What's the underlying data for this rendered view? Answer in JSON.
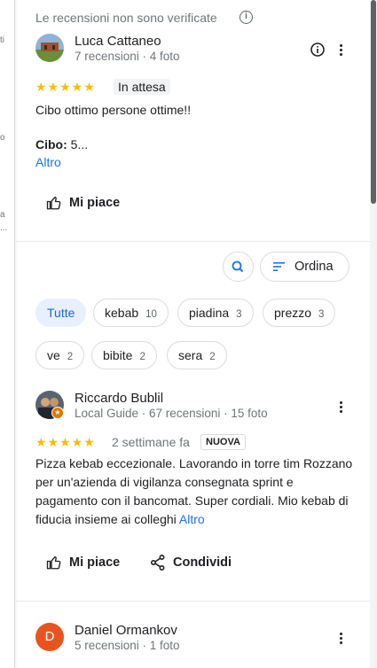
{
  "left_strip": {
    "fragments": [
      "ti",
      "o",
      "a",
      "..."
    ]
  },
  "header": {
    "unverified_note": "Le recensioni non sono verificate"
  },
  "review1": {
    "author": "Luca Cattaneo",
    "meta": "7 recensioni · 4 foto",
    "rating": 5,
    "stars": "★★★★★",
    "status": "In attesa",
    "text": "Cibo ottimo persone ottime!!",
    "food_label": "Cibo:",
    "food_value": " 5...",
    "more": "Altro",
    "like": "Mi piace"
  },
  "controls": {
    "sort_label": "Ordina"
  },
  "filters": [
    {
      "label": "Tutte",
      "count": ""
    },
    {
      "label": "kebab",
      "count": "10"
    },
    {
      "label": "piadina",
      "count": "3"
    },
    {
      "label": "prezzo",
      "count": "3"
    },
    {
      "label": "ve",
      "count": "2"
    },
    {
      "label": "bibite",
      "count": "2"
    },
    {
      "label": "sera",
      "count": "2"
    }
  ],
  "review2": {
    "author": "Riccardo Bublil",
    "meta": "Local Guide · 67 recensioni · 15 foto",
    "rating": 5,
    "stars": "★★★★★",
    "time": "2 settimane fa",
    "badge": "NUOVA",
    "text": "Pizza kebab eccezionale.  Lavorando in torre tim Rozzano per un'azienda di vigilanza consegnata sprint e pagamento con il bancomat.  Super cordiali. Mio kebab di fiducia insieme ai colleghi",
    "more": "Altro",
    "like": "Mi piace",
    "share": "Condividi"
  },
  "review3": {
    "author": "Daniel Ormankov",
    "avatar_letter": "D",
    "meta": "5 recensioni · 1 foto"
  },
  "colors": {
    "accent": "#1a73e8",
    "star": "#fbbc04",
    "avatar_d": "#e8541f"
  }
}
